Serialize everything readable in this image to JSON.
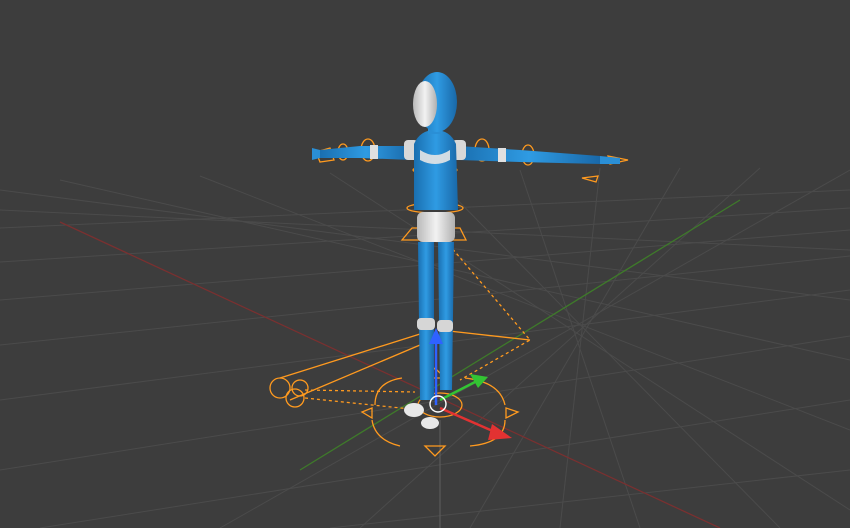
{
  "viewport": {
    "background": "#3d3d3d",
    "grid_color": "#4a4a4a",
    "axis_x_color": "#7a3232",
    "axis_y_color": "#3f7a2a",
    "rig_color": "#ff9a1f",
    "character_color": "#2a8fd6",
    "character_accent": "#e6e6e6"
  },
  "scene": {
    "object": "character-rig",
    "controls": [
      "root-move-gizmo",
      "ik-foot-controls",
      "pole-targets",
      "arm-rotation-rings",
      "hip-control"
    ],
    "transform_gizmo_axes": [
      "x-red-arrow",
      "y-green-arrow",
      "z-blue-arrow"
    ]
  }
}
